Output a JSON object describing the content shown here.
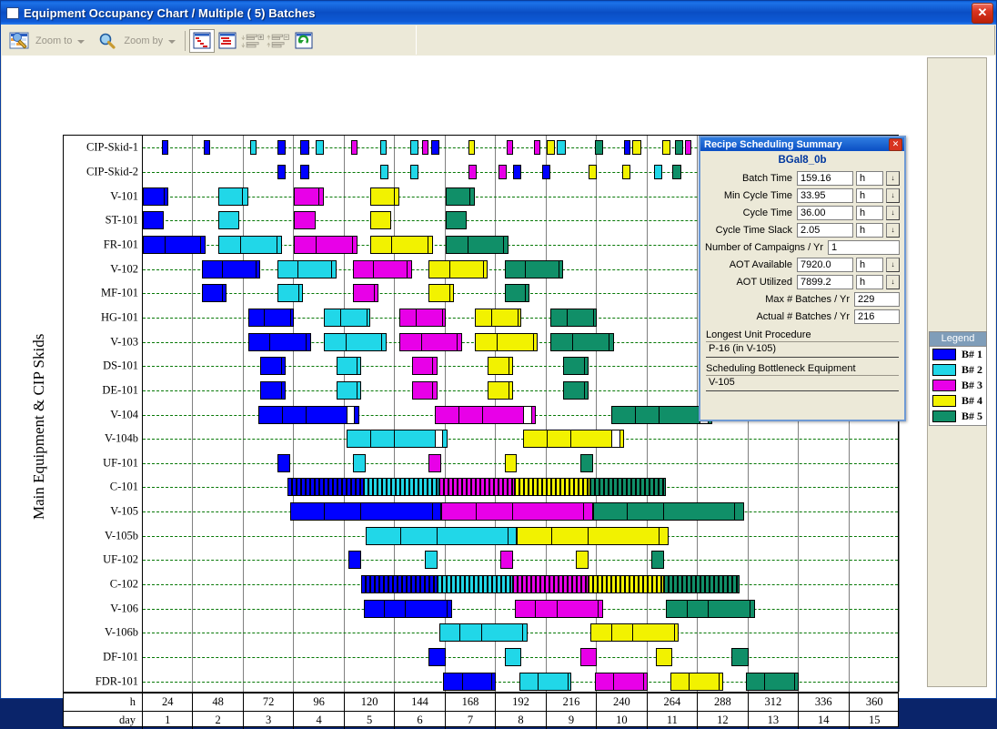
{
  "window": {
    "title": "Equipment Occupancy Chart / Multiple ( 5) Batches",
    "close_label": "✕"
  },
  "toolbar": {
    "zoom_to_label": "Zoom to",
    "zoom_by_label": "Zoom by",
    "icons": [
      "chart-edit-icon",
      "magnifier-icon",
      "gantt-chart-icon",
      "gantt-chart-alt-icon",
      "expand-rows-icon",
      "collapse-rows-icon",
      "refresh-icon"
    ]
  },
  "chart": {
    "y_axis_title": "Main Equipment & CIP Skids",
    "rows": [
      "CIP-Skid-1",
      "CIP-Skid-2",
      "V-101",
      "ST-101",
      "FR-101",
      "V-102",
      "MF-101",
      "HG-101",
      "V-103",
      "DS-101",
      "DE-101",
      "V-104",
      "V-104b",
      "UF-101",
      "C-101",
      "V-105",
      "V-105b",
      "UF-102",
      "C-102",
      "V-106",
      "V-106b",
      "DF-101",
      "FDR-101"
    ],
    "axis": {
      "hour_label": "h",
      "day_label": "day",
      "hours": [
        24,
        48,
        72,
        96,
        120,
        144,
        168,
        192,
        216,
        240,
        264,
        288,
        312,
        336,
        360
      ],
      "days": [
        1,
        2,
        3,
        4,
        5,
        6,
        7,
        8,
        9,
        10,
        11,
        12,
        13,
        14,
        15
      ],
      "x_min_hours": 0,
      "x_max_hours": 360
    }
  },
  "legend": {
    "title": "Legend",
    "entries": [
      {
        "label": "B# 1",
        "color": "#0000ff"
      },
      {
        "label": "B# 2",
        "color": "#21d7e8"
      },
      {
        "label": "B# 3",
        "color": "#e800e8"
      },
      {
        "label": "B# 4",
        "color": "#f2f200"
      },
      {
        "label": "B# 5",
        "color": "#108f68"
      }
    ]
  },
  "dialog": {
    "title": "Recipe Scheduling Summary",
    "close_label": "✕",
    "recipe_name": "BGal8_0b",
    "fields": [
      {
        "label": "Batch Time",
        "value": "159.16",
        "unit": "h",
        "spinner": true
      },
      {
        "label": "Min Cycle Time",
        "value": "33.95",
        "unit": "h",
        "spinner": true
      },
      {
        "label": "Cycle Time",
        "value": "36.00",
        "unit": "h",
        "spinner": true
      },
      {
        "label": "Cycle Time Slack",
        "value": "2.05",
        "unit": "h",
        "spinner": true
      },
      {
        "label": "Number of Campaigns / Yr",
        "value": "1",
        "unit": null,
        "spinner": false
      },
      {
        "label": "AOT Available",
        "value": "7920.0",
        "unit": "h",
        "spinner": true
      },
      {
        "label": "AOT Utilized",
        "value": "7899.2",
        "unit": "h",
        "spinner": true
      },
      {
        "label": "Max # Batches / Yr",
        "value": "229",
        "unit": null,
        "spinner": false,
        "narrow": true
      },
      {
        "label": "Actual # Batches / Yr",
        "value": "216",
        "unit": null,
        "spinner": false,
        "narrow": true
      }
    ],
    "longest_unit_procedure_label": "Longest Unit Procedure",
    "longest_unit_procedure_value": "P-16 (in V-105)",
    "bottleneck_label": "Scheduling Bottleneck Equipment",
    "bottleneck_value": "V-105",
    "spinner_glyph": "↓"
  },
  "chart_data": {
    "type": "bar",
    "subtype": "gantt",
    "title": "Equipment Occupancy Chart / Multiple ( 5) Batches",
    "xlabel": "h / day",
    "ylabel": "Main Equipment & CIP Skids",
    "xlim": [
      0,
      360
    ],
    "grid": true,
    "legend_position": "right",
    "batch_colors": [
      "#0000ff",
      "#21d7e8",
      "#e800e8",
      "#f2f200",
      "#108f68"
    ],
    "cycle_time_h": 36,
    "tasks": [
      {
        "row": "CIP-Skid-1",
        "batch": 1,
        "start": 9,
        "end": 12
      },
      {
        "row": "CIP-Skid-1",
        "batch": 1,
        "start": 29,
        "end": 32
      },
      {
        "row": "CIP-Skid-1",
        "batch": 2,
        "start": 51,
        "end": 54
      },
      {
        "row": "CIP-Skid-1",
        "batch": 1,
        "start": 64,
        "end": 68
      },
      {
        "row": "CIP-Skid-1",
        "batch": 1,
        "start": 75,
        "end": 79
      },
      {
        "row": "CIP-Skid-1",
        "batch": 2,
        "start": 82,
        "end": 86
      },
      {
        "row": "CIP-Skid-1",
        "batch": 3,
        "start": 99,
        "end": 102
      },
      {
        "row": "CIP-Skid-1",
        "batch": 2,
        "start": 113,
        "end": 116
      },
      {
        "row": "CIP-Skid-1",
        "batch": 2,
        "start": 127,
        "end": 131
      },
      {
        "row": "CIP-Skid-1",
        "batch": 3,
        "start": 133,
        "end": 136
      },
      {
        "row": "CIP-Skid-1",
        "batch": 1,
        "start": 137,
        "end": 141
      },
      {
        "row": "CIP-Skid-1",
        "batch": 4,
        "start": 155,
        "end": 158
      },
      {
        "row": "CIP-Skid-1",
        "batch": 3,
        "start": 173,
        "end": 176
      },
      {
        "row": "CIP-Skid-1",
        "batch": 3,
        "start": 186,
        "end": 189
      },
      {
        "row": "CIP-Skid-1",
        "batch": 4,
        "start": 192,
        "end": 196
      },
      {
        "row": "CIP-Skid-1",
        "batch": 2,
        "start": 197,
        "end": 201
      },
      {
        "row": "CIP-Skid-1",
        "batch": 5,
        "start": 215,
        "end": 219
      },
      {
        "row": "CIP-Skid-1",
        "batch": 1,
        "start": 229,
        "end": 232
      },
      {
        "row": "CIP-Skid-1",
        "batch": 4,
        "start": 233,
        "end": 237
      },
      {
        "row": "CIP-Skid-1",
        "batch": 4,
        "start": 247,
        "end": 251
      },
      {
        "row": "CIP-Skid-1",
        "batch": 5,
        "start": 253,
        "end": 257
      },
      {
        "row": "CIP-Skid-1",
        "batch": 3,
        "start": 258,
        "end": 261
      },
      {
        "row": "CIP-Skid-1",
        "batch": 5,
        "start": 293,
        "end": 297
      },
      {
        "row": "CIP-Skid-2",
        "batch": 1,
        "start": 64,
        "end": 68
      },
      {
        "row": "CIP-Skid-2",
        "batch": 1,
        "start": 75,
        "end": 79
      },
      {
        "row": "CIP-Skid-2",
        "batch": 2,
        "start": 113,
        "end": 117
      },
      {
        "row": "CIP-Skid-2",
        "batch": 2,
        "start": 127,
        "end": 131
      },
      {
        "row": "CIP-Skid-2",
        "batch": 3,
        "start": 155,
        "end": 159
      },
      {
        "row": "CIP-Skid-2",
        "batch": 3,
        "start": 169,
        "end": 173
      },
      {
        "row": "CIP-Skid-2",
        "batch": 1,
        "start": 176,
        "end": 180
      },
      {
        "row": "CIP-Skid-2",
        "batch": 1,
        "start": 190,
        "end": 194
      },
      {
        "row": "CIP-Skid-2",
        "batch": 4,
        "start": 212,
        "end": 216
      },
      {
        "row": "CIP-Skid-2",
        "batch": 4,
        "start": 228,
        "end": 232
      },
      {
        "row": "CIP-Skid-2",
        "batch": 2,
        "start": 243,
        "end": 247
      },
      {
        "row": "CIP-Skid-2",
        "batch": 5,
        "start": 252,
        "end": 256
      },
      {
        "row": "CIP-Skid-2",
        "batch": 5,
        "start": 272,
        "end": 276
      },
      {
        "row": "V-101",
        "batch": 1,
        "start": 0,
        "end": 12
      },
      {
        "row": "V-101",
        "batch": 2,
        "start": 36,
        "end": 50
      },
      {
        "row": "V-101",
        "batch": 3,
        "start": 72,
        "end": 86
      },
      {
        "row": "V-101",
        "batch": 4,
        "start": 108,
        "end": 122
      },
      {
        "row": "V-101",
        "batch": 5,
        "start": 144,
        "end": 158
      },
      {
        "row": "ST-101",
        "batch": 1,
        "start": 0,
        "end": 10
      },
      {
        "row": "ST-101",
        "batch": 2,
        "start": 36,
        "end": 46
      },
      {
        "row": "ST-101",
        "batch": 3,
        "start": 72,
        "end": 82
      },
      {
        "row": "ST-101",
        "batch": 4,
        "start": 108,
        "end": 118
      },
      {
        "row": "ST-101",
        "batch": 5,
        "start": 144,
        "end": 154
      },
      {
        "row": "FR-101",
        "batch": 1,
        "start": 0,
        "end": 30
      },
      {
        "row": "FR-101",
        "batch": 2,
        "start": 36,
        "end": 66
      },
      {
        "row": "FR-101",
        "batch": 3,
        "start": 72,
        "end": 102
      },
      {
        "row": "FR-101",
        "batch": 4,
        "start": 108,
        "end": 138
      },
      {
        "row": "FR-101",
        "batch": 5,
        "start": 144,
        "end": 174
      },
      {
        "row": "V-102",
        "batch": 1,
        "start": 28,
        "end": 56
      },
      {
        "row": "V-102",
        "batch": 2,
        "start": 64,
        "end": 92
      },
      {
        "row": "V-102",
        "batch": 3,
        "start": 100,
        "end": 128
      },
      {
        "row": "V-102",
        "batch": 4,
        "start": 136,
        "end": 164
      },
      {
        "row": "V-102",
        "batch": 5,
        "start": 172,
        "end": 200
      },
      {
        "row": "MF-101",
        "batch": 1,
        "start": 28,
        "end": 40
      },
      {
        "row": "MF-101",
        "batch": 2,
        "start": 64,
        "end": 76
      },
      {
        "row": "MF-101",
        "batch": 3,
        "start": 100,
        "end": 112
      },
      {
        "row": "MF-101",
        "batch": 4,
        "start": 136,
        "end": 148
      },
      {
        "row": "MF-101",
        "batch": 5,
        "start": 172,
        "end": 184
      },
      {
        "row": "HG-101",
        "batch": 1,
        "start": 50,
        "end": 72
      },
      {
        "row": "HG-101",
        "batch": 2,
        "start": 86,
        "end": 108
      },
      {
        "row": "HG-101",
        "batch": 3,
        "start": 122,
        "end": 144
      },
      {
        "row": "HG-101",
        "batch": 4,
        "start": 158,
        "end": 180
      },
      {
        "row": "HG-101",
        "batch": 5,
        "start": 194,
        "end": 216
      },
      {
        "row": "V-103",
        "batch": 1,
        "start": 50,
        "end": 80
      },
      {
        "row": "V-103",
        "batch": 2,
        "start": 86,
        "end": 116
      },
      {
        "row": "V-103",
        "batch": 3,
        "start": 122,
        "end": 152
      },
      {
        "row": "V-103",
        "batch": 4,
        "start": 158,
        "end": 188
      },
      {
        "row": "V-103",
        "batch": 5,
        "start": 194,
        "end": 224
      },
      {
        "row": "DS-101",
        "batch": 1,
        "start": 56,
        "end": 68
      },
      {
        "row": "DS-101",
        "batch": 2,
        "start": 92,
        "end": 104
      },
      {
        "row": "DS-101",
        "batch": 3,
        "start": 128,
        "end": 140
      },
      {
        "row": "DS-101",
        "batch": 4,
        "start": 164,
        "end": 176
      },
      {
        "row": "DS-101",
        "batch": 5,
        "start": 200,
        "end": 212
      },
      {
        "row": "DE-101",
        "batch": 1,
        "start": 56,
        "end": 68
      },
      {
        "row": "DE-101",
        "batch": 2,
        "start": 92,
        "end": 104
      },
      {
        "row": "DE-101",
        "batch": 3,
        "start": 128,
        "end": 140
      },
      {
        "row": "DE-101",
        "batch": 4,
        "start": 164,
        "end": 176
      },
      {
        "row": "DE-101",
        "batch": 5,
        "start": 200,
        "end": 212
      },
      {
        "row": "V-104",
        "batch": 1,
        "start": 55,
        "end": 103
      },
      {
        "row": "V-104",
        "batch": 3,
        "start": 139,
        "end": 187
      },
      {
        "row": "V-104",
        "batch": 5,
        "start": 223,
        "end": 271
      },
      {
        "row": "V-104b",
        "batch": 2,
        "start": 97,
        "end": 145
      },
      {
        "row": "V-104b",
        "batch": 4,
        "start": 181,
        "end": 229
      },
      {
        "row": "UF-101",
        "batch": 1,
        "start": 64,
        "end": 70
      },
      {
        "row": "UF-101",
        "batch": 2,
        "start": 100,
        "end": 106
      },
      {
        "row": "UF-101",
        "batch": 3,
        "start": 136,
        "end": 142
      },
      {
        "row": "UF-101",
        "batch": 4,
        "start": 172,
        "end": 178
      },
      {
        "row": "UF-101",
        "batch": 5,
        "start": 208,
        "end": 214
      },
      {
        "row": "C-101",
        "batch": 1,
        "start": 69,
        "end": 105
      },
      {
        "row": "C-101",
        "batch": 2,
        "start": 105,
        "end": 141
      },
      {
        "row": "C-101",
        "batch": 3,
        "start": 141,
        "end": 177
      },
      {
        "row": "C-101",
        "batch": 4,
        "start": 177,
        "end": 213
      },
      {
        "row": "C-101",
        "batch": 5,
        "start": 213,
        "end": 249
      },
      {
        "row": "V-105",
        "batch": 1,
        "start": 70,
        "end": 142
      },
      {
        "row": "V-105",
        "batch": 3,
        "start": 142,
        "end": 214
      },
      {
        "row": "V-105",
        "batch": 5,
        "start": 214,
        "end": 286
      },
      {
        "row": "V-105b",
        "batch": 2,
        "start": 106,
        "end": 178
      },
      {
        "row": "V-105b",
        "batch": 4,
        "start": 178,
        "end": 250
      },
      {
        "row": "UF-102",
        "batch": 1,
        "start": 98,
        "end": 104
      },
      {
        "row": "UF-102",
        "batch": 2,
        "start": 134,
        "end": 140
      },
      {
        "row": "UF-102",
        "batch": 3,
        "start": 170,
        "end": 176
      },
      {
        "row": "UF-102",
        "batch": 4,
        "start": 206,
        "end": 212
      },
      {
        "row": "UF-102",
        "batch": 5,
        "start": 242,
        "end": 248
      },
      {
        "row": "C-102",
        "batch": 1,
        "start": 104,
        "end": 140
      },
      {
        "row": "C-102",
        "batch": 2,
        "start": 140,
        "end": 176
      },
      {
        "row": "C-102",
        "batch": 3,
        "start": 176,
        "end": 212
      },
      {
        "row": "C-102",
        "batch": 4,
        "start": 212,
        "end": 248
      },
      {
        "row": "C-102",
        "batch": 5,
        "start": 248,
        "end": 284
      },
      {
        "row": "V-106",
        "batch": 1,
        "start": 105,
        "end": 147
      },
      {
        "row": "V-106",
        "batch": 3,
        "start": 177,
        "end": 219
      },
      {
        "row": "V-106",
        "batch": 5,
        "start": 249,
        "end": 291
      },
      {
        "row": "V-106b",
        "batch": 2,
        "start": 141,
        "end": 183
      },
      {
        "row": "V-106b",
        "batch": 4,
        "start": 213,
        "end": 255
      },
      {
        "row": "DF-101",
        "batch": 1,
        "start": 136,
        "end": 144
      },
      {
        "row": "DF-101",
        "batch": 2,
        "start": 172,
        "end": 180
      },
      {
        "row": "DF-101",
        "batch": 3,
        "start": 208,
        "end": 216
      },
      {
        "row": "DF-101",
        "batch": 4,
        "start": 244,
        "end": 252
      },
      {
        "row": "DF-101",
        "batch": 5,
        "start": 280,
        "end": 288
      },
      {
        "row": "FDR-101",
        "batch": 1,
        "start": 143,
        "end": 168
      },
      {
        "row": "FDR-101",
        "batch": 2,
        "start": 179,
        "end": 204
      },
      {
        "row": "FDR-101",
        "batch": 3,
        "start": 215,
        "end": 240
      },
      {
        "row": "FDR-101",
        "batch": 4,
        "start": 251,
        "end": 276
      },
      {
        "row": "FDR-101",
        "batch": 5,
        "start": 287,
        "end": 312
      }
    ],
    "striped_rows": [
      "C-101",
      "C-102"
    ]
  }
}
